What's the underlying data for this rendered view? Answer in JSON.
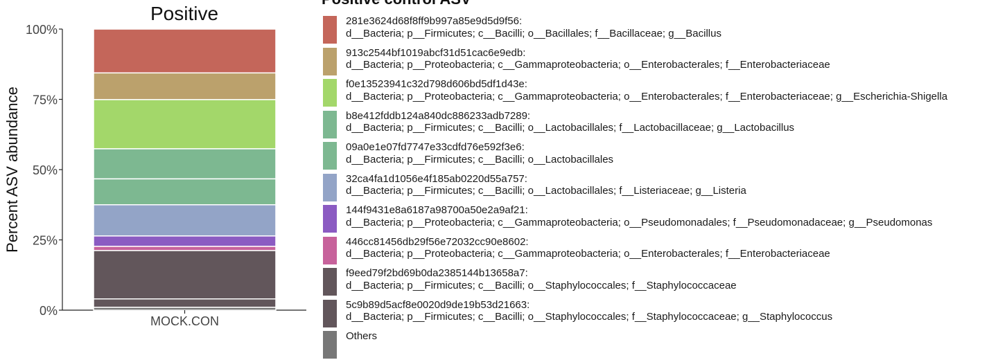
{
  "chart_data": {
    "type": "bar",
    "stacked": true,
    "title": "Positive",
    "xlabel": "",
    "ylabel": "Percent ASV abundance",
    "categories": [
      "MOCK.CON"
    ],
    "ylim": [
      0,
      100
    ],
    "yticks": [
      "0%",
      "25%",
      "50%",
      "75%",
      "100%"
    ],
    "grid": false,
    "legend_title": "Positive control ASV",
    "legend_position": "right",
    "series": [
      {
        "id": "281e3624d68f8ff9b997a85e9d5d9f56:",
        "taxonomy": "d__Bacteria; p__Firmicutes; c__Bacilli; o__Bacillales; f__Bacillaceae; g__Bacillus",
        "color": "#c4665a",
        "values": [
          15.6
        ]
      },
      {
        "id": "913c2544bf1019abcf31d51cac6e9edb:",
        "taxonomy": "d__Bacteria; p__Proteobacteria; c__Gammaproteobacteria; o__Enterobacterales; f__Enterobacteriaceae",
        "color": "#bba16c",
        "values": [
          9.5
        ]
      },
      {
        "id": "f0e13523941c32d798d606bd5df1d43e:",
        "taxonomy": "d__Bacteria; p__Proteobacteria; c__Gammaproteobacteria; o__Enterobacterales; f__Enterobacteriaceae; g__Escherichia-Shigella",
        "color": "#a3d76a",
        "values": [
          17.5
        ]
      },
      {
        "id": "b8e412fddb124a840dc886233adb7289:",
        "taxonomy": "d__Bacteria; p__Firmicutes; c__Bacilli; o__Lactobacillales; f__Lactobacillaceae; g__Lactobacillus",
        "color": "#7db891",
        "values": [
          10.7
        ]
      },
      {
        "id": "09a0e1e07fd7747e33cdfd76e592f3e6:",
        "taxonomy": "d__Bacteria; p__Firmicutes; c__Bacilli; o__Lactobacillales",
        "color": "#7db891",
        "values": [
          9.2
        ]
      },
      {
        "id": "32ca4fa1d1056e4f185ab0220d55a757:",
        "taxonomy": "d__Bacteria; p__Firmicutes; c__Bacilli; o__Lactobacillales; f__Listeriaceae; g__Listeria",
        "color": "#93a4c7",
        "values": [
          11.1
        ]
      },
      {
        "id": "144f9431e8a6187a98700a50e2a9af21:",
        "taxonomy": "d__Bacteria; p__Proteobacteria; c__Gammaproteobacteria; o__Pseudomonadales; f__Pseudomonadaceae; g__Pseudomonas",
        "color": "#8b5bc2",
        "values": [
          3.7
        ]
      },
      {
        "id": "446cc81456db29f56e72032cc90e8602:",
        "taxonomy": "d__Bacteria; p__Proteobacteria; c__Gammaproteobacteria; o__Enterobacterales; f__Enterobacteriaceae",
        "color": "#c7629b",
        "values": [
          1.5
        ]
      },
      {
        "id": "f9eed79f2bd69b0da2385144b13658a7:",
        "taxonomy": "d__Bacteria; p__Firmicutes; c__Bacilli; o__Staphylococcales; f__Staphylococcaceae",
        "color": "#62565b",
        "values": [
          17.2
        ]
      },
      {
        "id": "5c9b89d5acf8e0020d9de19b53d21663:",
        "taxonomy": "d__Bacteria; p__Firmicutes; c__Bacilli; o__Staphylococcales; f__Staphylococcaceae; g__Staphylococcus",
        "color": "#62565b",
        "values": [
          3.0
        ]
      },
      {
        "id": "Others",
        "taxonomy": "",
        "color": "#777777",
        "values": [
          1.0
        ]
      }
    ]
  }
}
